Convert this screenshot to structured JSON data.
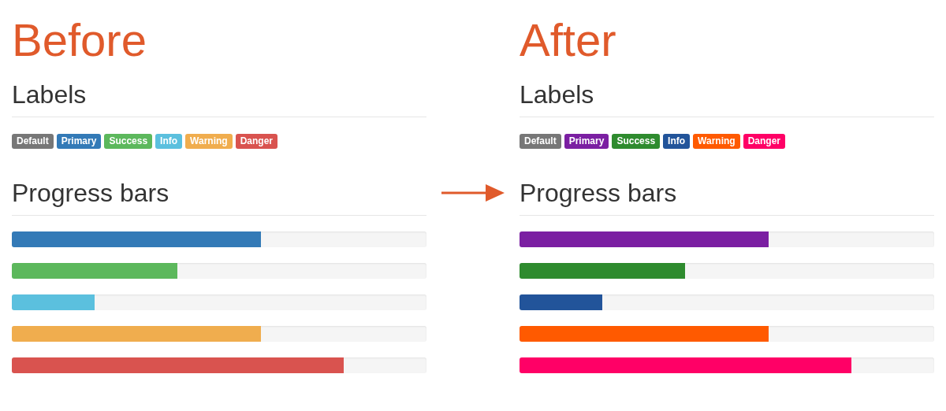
{
  "panels": [
    {
      "title": "Before",
      "labels_heading": "Labels",
      "labels": [
        {
          "text": "Default",
          "color": "#777777"
        },
        {
          "text": "Primary",
          "color": "#337ab7"
        },
        {
          "text": "Success",
          "color": "#5cb85c"
        },
        {
          "text": "Info",
          "color": "#5bc0de"
        },
        {
          "text": "Warning",
          "color": "#f0ad4e"
        },
        {
          "text": "Danger",
          "color": "#d9534f"
        }
      ],
      "progress_heading": "Progress bars",
      "bars": [
        {
          "level": 0.6,
          "color": "#337ab7"
        },
        {
          "level": 0.4,
          "color": "#5cb85c"
        },
        {
          "level": 0.2,
          "color": "#5bc0de"
        },
        {
          "level": 0.6,
          "color": "#f0ad4e"
        },
        {
          "level": 0.8,
          "color": "#d9534f"
        }
      ]
    },
    {
      "title": "After",
      "labels_heading": "Labels",
      "labels": [
        {
          "text": "Default",
          "color": "#777777"
        },
        {
          "text": "Primary",
          "color": "#7b1fa2"
        },
        {
          "text": "Success",
          "color": "#2e8b2e"
        },
        {
          "text": "Info",
          "color": "#22549a"
        },
        {
          "text": "Warning",
          "color": "#ff5a00"
        },
        {
          "text": "Danger",
          "color": "#ff0066"
        }
      ],
      "progress_heading": "Progress bars",
      "bars": [
        {
          "level": 0.6,
          "color": "#7b1fa2"
        },
        {
          "level": 0.4,
          "color": "#2e8b2e"
        },
        {
          "level": 0.2,
          "color": "#22549a"
        },
        {
          "level": 0.6,
          "color": "#ff5a00"
        },
        {
          "level": 0.8,
          "color": "#ff0066"
        }
      ]
    }
  ]
}
